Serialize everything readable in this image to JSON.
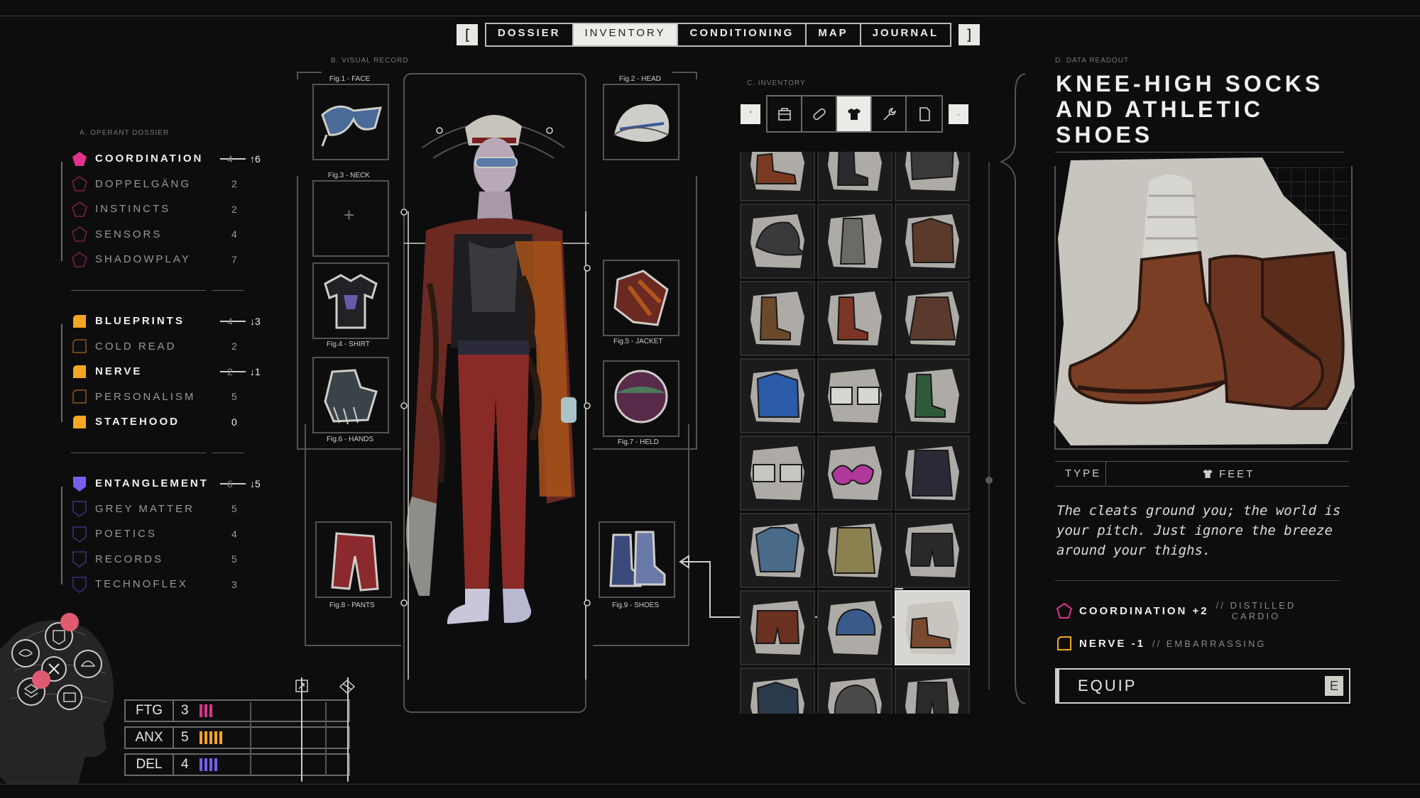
{
  "nav": {
    "left_bracket": "[",
    "right_bracket": "]",
    "tabs": [
      {
        "label": "DOSSIER",
        "active": false
      },
      {
        "label": "INVENTORY",
        "active": true
      },
      {
        "label": "CONDITIONING",
        "active": false
      },
      {
        "label": "MAP",
        "active": false
      },
      {
        "label": "JOURNAL",
        "active": false
      }
    ]
  },
  "dossier": {
    "label": "A. OPERANT DOSSIER",
    "groups": [
      {
        "name": "COORDINATION",
        "old_value": "4",
        "change": "↑6",
        "color": "#e0338a",
        "shape": "pentagon",
        "skills": [
          {
            "name": "DOPPELGÄNG",
            "value": "2"
          },
          {
            "name": "INSTINCTS",
            "value": "2"
          },
          {
            "name": "SENSORS",
            "value": "4"
          },
          {
            "name": "SHADOWPLAY",
            "value": "7"
          }
        ]
      },
      {
        "name": "BLUEPRINTS",
        "old_value": "4",
        "change": "↓3",
        "color": "#f5a623",
        "shape": "leaf",
        "skills": [
          {
            "name": "COLD READ",
            "value": "2"
          },
          {
            "name": "NERVE",
            "value": "2",
            "change": "↓1",
            "highlight": true
          },
          {
            "name": "PERSONALISM",
            "value": "5"
          },
          {
            "name": "STATEHOOD",
            "value": "0",
            "highlight": true
          }
        ]
      },
      {
        "name": "ENTANGLEMENT",
        "old_value": "6",
        "change": "↓5",
        "color": "#7b5cf0",
        "shape": "shield",
        "skills": [
          {
            "name": "GREY MATTER",
            "value": "5"
          },
          {
            "name": "POETICS",
            "value": "4"
          },
          {
            "name": "RECORDS",
            "value": "5"
          },
          {
            "name": "TECHNOFLEX",
            "value": "3"
          }
        ]
      }
    ]
  },
  "stats": [
    {
      "label": "FTG",
      "value": "3",
      "color": "#e0338a"
    },
    {
      "label": "ANX",
      "value": "5",
      "color": "#f5a623"
    },
    {
      "label": "DEL",
      "value": "4",
      "color": "#7b5cf0"
    }
  ],
  "visual_record": {
    "label": "B. VISUAL RECORD",
    "slots": [
      {
        "caption": "Fig.1 - FACE",
        "icon": "sunglasses-icon"
      },
      {
        "caption": "Fig.2 - HEAD",
        "icon": "cap-icon"
      },
      {
        "caption": "Fig.3 - NECK",
        "icon": "empty-slot-plus-icon"
      },
      {
        "caption": "Fig.4 - SHIRT",
        "icon": "tshirt-icon"
      },
      {
        "caption": "Fig.5 - JACKET",
        "icon": "jacket-icon"
      },
      {
        "caption": "Fig.6 - HANDS",
        "icon": "gloves-icon"
      },
      {
        "caption": "Fig.7 - HELD",
        "icon": "ball-icon"
      },
      {
        "caption": "Fig.8 - PANTS",
        "icon": "pants-icon"
      },
      {
        "caption": "Fig.9 - SHOES",
        "icon": "boots-icon"
      }
    ]
  },
  "inventory": {
    "label": "C. INVENTORY",
    "tools": [
      "bag-icon",
      "pill-icon",
      "tshirt-icon",
      "wrench-icon",
      "document-icon"
    ],
    "active_tool": 2,
    "prev_key": "'",
    "next_key": "·",
    "selected_index": 20,
    "items": [
      {
        "icon": "shoes-icon",
        "color": "#7a3a22"
      },
      {
        "icon": "boots-icon",
        "color": "#2a2a2c"
      },
      {
        "icon": "studded-icon",
        "color": "#3a3838"
      },
      {
        "icon": "cap-icon",
        "color": "#3a3a3c"
      },
      {
        "icon": "sandals-icon",
        "color": "#6a6a66"
      },
      {
        "icon": "jacket-icon",
        "color": "#5a3a2a"
      },
      {
        "icon": "boots-icon",
        "color": "#6a4a2a"
      },
      {
        "icon": "boots-icon",
        "color": "#7a3524"
      },
      {
        "icon": "skirt-icon",
        "color": "#5a3a2c"
      },
      {
        "icon": "jacket-icon",
        "color": "#2a5aa8"
      },
      {
        "icon": "glasses-icon",
        "color": "#d8d6d2"
      },
      {
        "icon": "boots-icon",
        "color": "#2f5a3a"
      },
      {
        "icon": "glasses-icon",
        "color": "#c8c6c2"
      },
      {
        "icon": "sunglasses-icon",
        "color": "#b0389a"
      },
      {
        "icon": "coat-icon",
        "color": "#2a2a36"
      },
      {
        "icon": "shirt-icon",
        "color": "#4a6a8a"
      },
      {
        "icon": "coat-icon",
        "color": "#8a8050"
      },
      {
        "icon": "shorts-icon",
        "color": "#2a2828"
      },
      {
        "icon": "shorts-icon",
        "color": "#6a3020"
      },
      {
        "icon": "hat-icon",
        "color": "#3a5a8a"
      },
      {
        "icon": "shoes-icon",
        "color": "#7a4a30"
      },
      {
        "icon": "jacket-icon",
        "color": "#2a3a4a"
      },
      {
        "icon": "helmet-icon",
        "color": "#4a4848"
      },
      {
        "icon": "pants-icon",
        "color": "#2a2a2a"
      }
    ]
  },
  "readout": {
    "label": "D. DATA READOUT",
    "title_lines": [
      "KNEE-HIGH SOCKS",
      "AND ATHLETIC",
      "SHOES"
    ],
    "type_key": "TYPE",
    "type_value": "FEET",
    "description": "The cleats ground you; the world is your pitch. Just ignore the breeze around your thighs.",
    "effects": [
      {
        "name": "COORDINATION +2",
        "note_line1": "// DISTILLED",
        "note_line2": "CARDIO",
        "color": "#e0338a",
        "shape": "pentagon"
      },
      {
        "name": "NERVE -1",
        "note_line1": "// EMBARRASSING",
        "note_line2": "",
        "color": "#f5a623",
        "shape": "leaf"
      }
    ],
    "equip_label": "EQUIP",
    "equip_key": "E"
  }
}
